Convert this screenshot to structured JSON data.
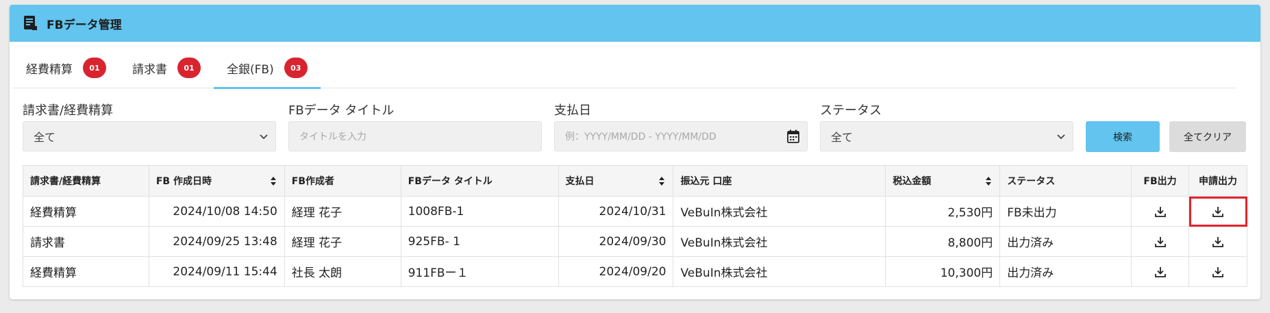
{
  "header": {
    "title": "FBデータ管理",
    "icon": "document-icon"
  },
  "tabs": [
    {
      "label": "経費精算",
      "badge": "01"
    },
    {
      "label": "請求書",
      "badge": "01"
    },
    {
      "label": "全銀(FB)",
      "badge": "03",
      "active": true
    }
  ],
  "filters": {
    "type_label": "請求書/経費精算",
    "type_value": "全て",
    "title_label": "FBデータ タイトル",
    "title_placeholder": "タイトルを入力",
    "date_label": "支払日",
    "date_placeholder": "例：YYYY/MM/DD - YYYY/MM/DD",
    "status_label": "ステータス",
    "status_value": "全て",
    "search_button": "検索",
    "clear_button": "全てクリア"
  },
  "table": {
    "headers": {
      "type": "請求書/経費精算",
      "created_at": "FB 作成日時",
      "creator": "FB作成者",
      "title": "FBデータ タイトル",
      "pay_date": "支払日",
      "account": "振込元 口座",
      "amount": "税込金額",
      "status": "ステータス",
      "fb_output": "FB出力",
      "app_output": "申請出力"
    },
    "rows": [
      {
        "type": "経費精算",
        "created_at": "2024/10/08 14:50",
        "creator": "経理 花子",
        "title": "1008FB-1",
        "pay_date": "2024/10/31",
        "account": "VeBuIn株式会社",
        "amount": "2,530円",
        "status": "FB未出力"
      },
      {
        "type": "請求書",
        "created_at": "2024/09/25 13:48",
        "creator": "経理 花子",
        "title": "925FB- 1",
        "pay_date": "2024/09/30",
        "account": "VeBuIn株式会社",
        "amount": "8,800円",
        "status": "出力済み"
      },
      {
        "type": "経費精算",
        "created_at": "2024/09/11 15:44",
        "creator": "社長 太朗",
        "title": "911FBー１",
        "pay_date": "2024/09/20",
        "account": "VeBuIn株式会社",
        "amount": "10,300円",
        "status": "出力済み"
      }
    ]
  },
  "colors": {
    "header": "#62c4ef",
    "badge": "#d8242f",
    "highlight": "#e3222c"
  }
}
